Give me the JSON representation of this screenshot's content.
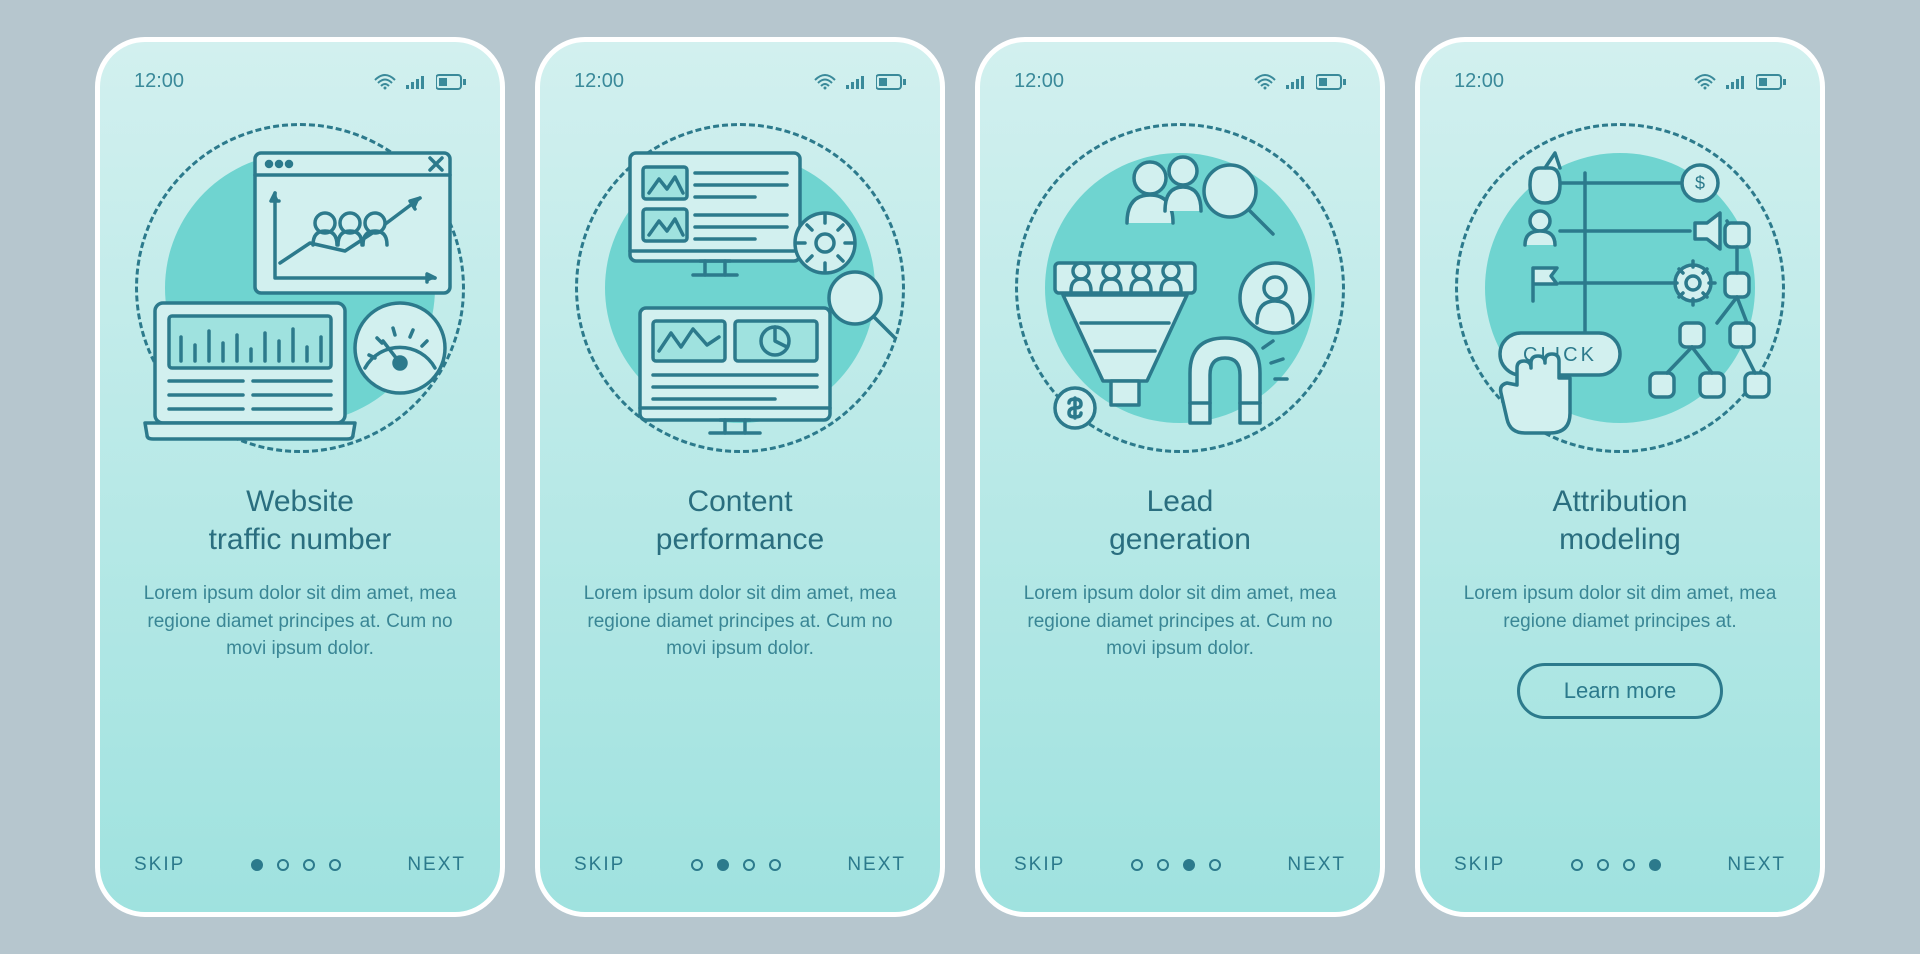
{
  "status": {
    "time": "12:00"
  },
  "nav": {
    "skip": "SKIP",
    "next": "NEXT"
  },
  "cta": {
    "learn_more": "Learn more",
    "click_label": "CLICK"
  },
  "screens": [
    {
      "title": "Website\ntraffic number",
      "body": "Lorem ipsum dolor sit dim amet, mea regione diamet principes at. Cum no movi ipsum dolor.",
      "active_dot": 0,
      "show_cta": false
    },
    {
      "title": "Content\nperformance",
      "body": "Lorem ipsum dolor sit dim amet, mea regione diamet principes at. Cum no movi ipsum dolor.",
      "active_dot": 1,
      "show_cta": false
    },
    {
      "title": "Lead\ngeneration",
      "body": "Lorem ipsum dolor sit dim amet, mea regione diamet principes at. Cum no movi ipsum dolor.",
      "active_dot": 2,
      "show_cta": false
    },
    {
      "title": "Attribution\nmodeling",
      "body": "Lorem ipsum dolor sit dim amet, mea regione diamet principes at.",
      "active_dot": 3,
      "show_cta": true
    }
  ],
  "colors": {
    "stroke": "#2c7a8c",
    "accent": "#6fd4d0"
  }
}
